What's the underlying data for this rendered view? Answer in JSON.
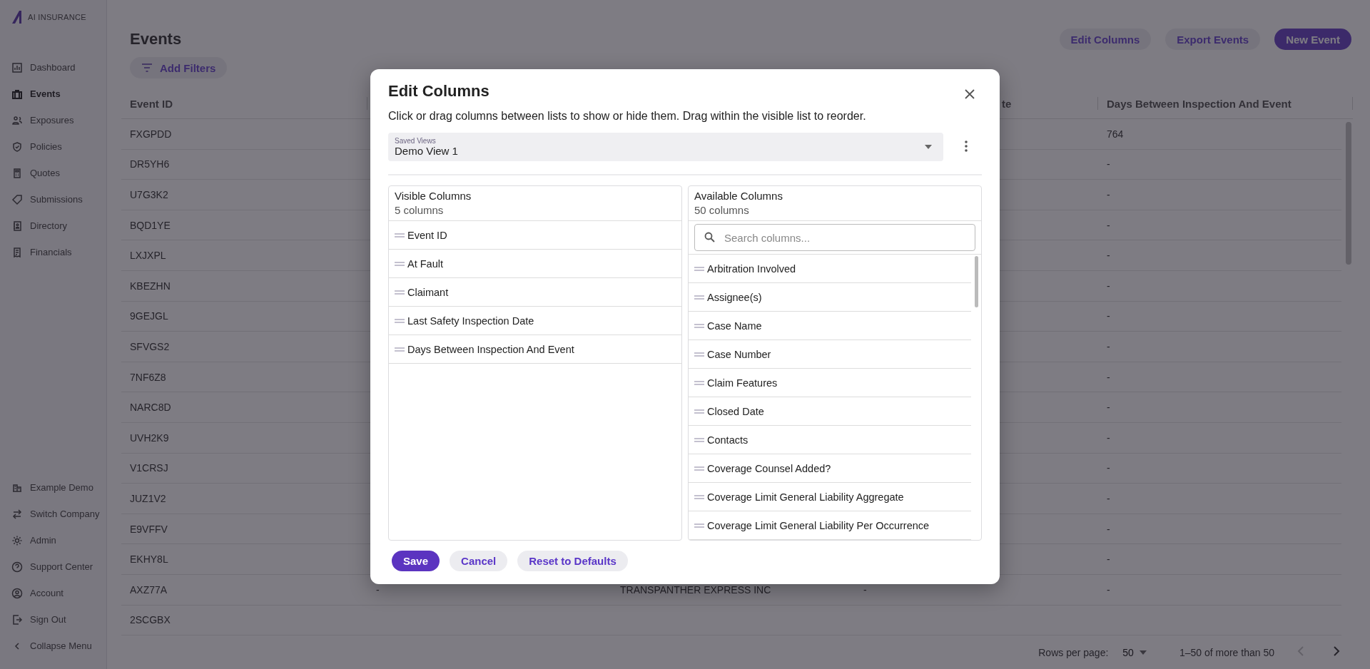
{
  "logo": {
    "text": "AI INSURANCE"
  },
  "sidebar": {
    "items": [
      {
        "label": "Dashboard",
        "selected": false
      },
      {
        "label": "Events",
        "selected": true
      },
      {
        "label": "Exposures",
        "selected": false
      },
      {
        "label": "Policies",
        "selected": false
      },
      {
        "label": "Quotes",
        "selected": false
      },
      {
        "label": "Submissions",
        "selected": false
      },
      {
        "label": "Directory",
        "selected": false
      },
      {
        "label": "Financials",
        "selected": false
      }
    ],
    "footer_items": [
      {
        "label": "Example Demo"
      },
      {
        "label": "Switch Company"
      },
      {
        "label": "Admin"
      },
      {
        "label": "Support Center"
      },
      {
        "label": "Account"
      },
      {
        "label": "Sign Out"
      },
      {
        "label": "Collapse Menu"
      }
    ]
  },
  "page": {
    "title": "Events",
    "filter_button": "Add Filters",
    "actions": [
      {
        "label": "Edit Columns",
        "kind": "secondary"
      },
      {
        "label": "Export Events",
        "kind": "secondary"
      },
      {
        "label": "New Event",
        "kind": "primary"
      }
    ]
  },
  "table": {
    "columns": [
      "Event ID",
      null,
      null,
      "te",
      "Days Between Inspection And Event"
    ],
    "rows": [
      {
        "cells": [
          "FXGPDD",
          null,
          null,
          null,
          "764"
        ]
      },
      {
        "cells": [
          "DR5YH6",
          null,
          null,
          null,
          "-"
        ]
      },
      {
        "cells": [
          "U7G3K2",
          null,
          null,
          null,
          "-"
        ]
      },
      {
        "cells": [
          "BQD1YE",
          null,
          null,
          null,
          "-"
        ]
      },
      {
        "cells": [
          "LXJXPL",
          null,
          null,
          null,
          "-"
        ]
      },
      {
        "cells": [
          "KBEZHN",
          null,
          null,
          null,
          "-"
        ]
      },
      {
        "cells": [
          "9GEJGL",
          null,
          null,
          null,
          "-"
        ]
      },
      {
        "cells": [
          "SFVGS2",
          null,
          null,
          null,
          "-"
        ]
      },
      {
        "cells": [
          "7NF6Z8",
          null,
          null,
          null,
          "-"
        ]
      },
      {
        "cells": [
          "NARC8D",
          null,
          null,
          null,
          "-"
        ]
      },
      {
        "cells": [
          "UVH2K9",
          null,
          null,
          null,
          "-"
        ]
      },
      {
        "cells": [
          "V1CRSJ",
          null,
          null,
          null,
          "-"
        ]
      },
      {
        "cells": [
          "JUZ1V2",
          null,
          null,
          null,
          "-"
        ]
      },
      {
        "cells": [
          "E9VFFV",
          null,
          null,
          null,
          "-"
        ]
      },
      {
        "cells": [
          "EKHY8L",
          null,
          null,
          null,
          "-"
        ]
      },
      {
        "cells": [
          "AXZ77A",
          "-",
          "TRANSPANTHER EXPRESS INC",
          "-",
          "-"
        ]
      },
      {
        "cells": [
          "2SCGBX",
          null,
          null,
          null,
          null
        ]
      }
    ]
  },
  "pagination": {
    "rows_per_page_label": "Rows per page:",
    "rows_per_page": "50",
    "range": "1–50 of more than 50",
    "previous_disabled": true
  },
  "modal": {
    "title": "Edit Columns",
    "description": "Click or drag columns between lists to show or hide them. Drag within the visible list to reorder.",
    "saved_views": {
      "label": "Saved Views",
      "value": "Demo View 1"
    },
    "visible_columns": {
      "title": "Visible Columns",
      "count": "5 columns",
      "items": [
        "Event ID",
        "At Fault",
        "Claimant",
        "Last Safety Inspection Date",
        "Days Between Inspection And Event"
      ]
    },
    "available_columns": {
      "title": "Available Columns",
      "count": "50 columns",
      "search_placeholder": "Search columns...",
      "items": [
        "Arbitration Involved",
        "Assignee(s)",
        "Case Name",
        "Case Number",
        "Claim Features",
        "Closed Date",
        "Contacts",
        "Coverage Counsel Added?",
        "Coverage Limit General Liability Aggregate",
        "Coverage Limit General Liability Per Occurrence"
      ]
    },
    "buttons": [
      {
        "label": "Save",
        "kind": "primary"
      },
      {
        "label": "Cancel",
        "kind": "secondary"
      },
      {
        "label": "Reset to Defaults",
        "kind": "secondary"
      }
    ]
  }
}
